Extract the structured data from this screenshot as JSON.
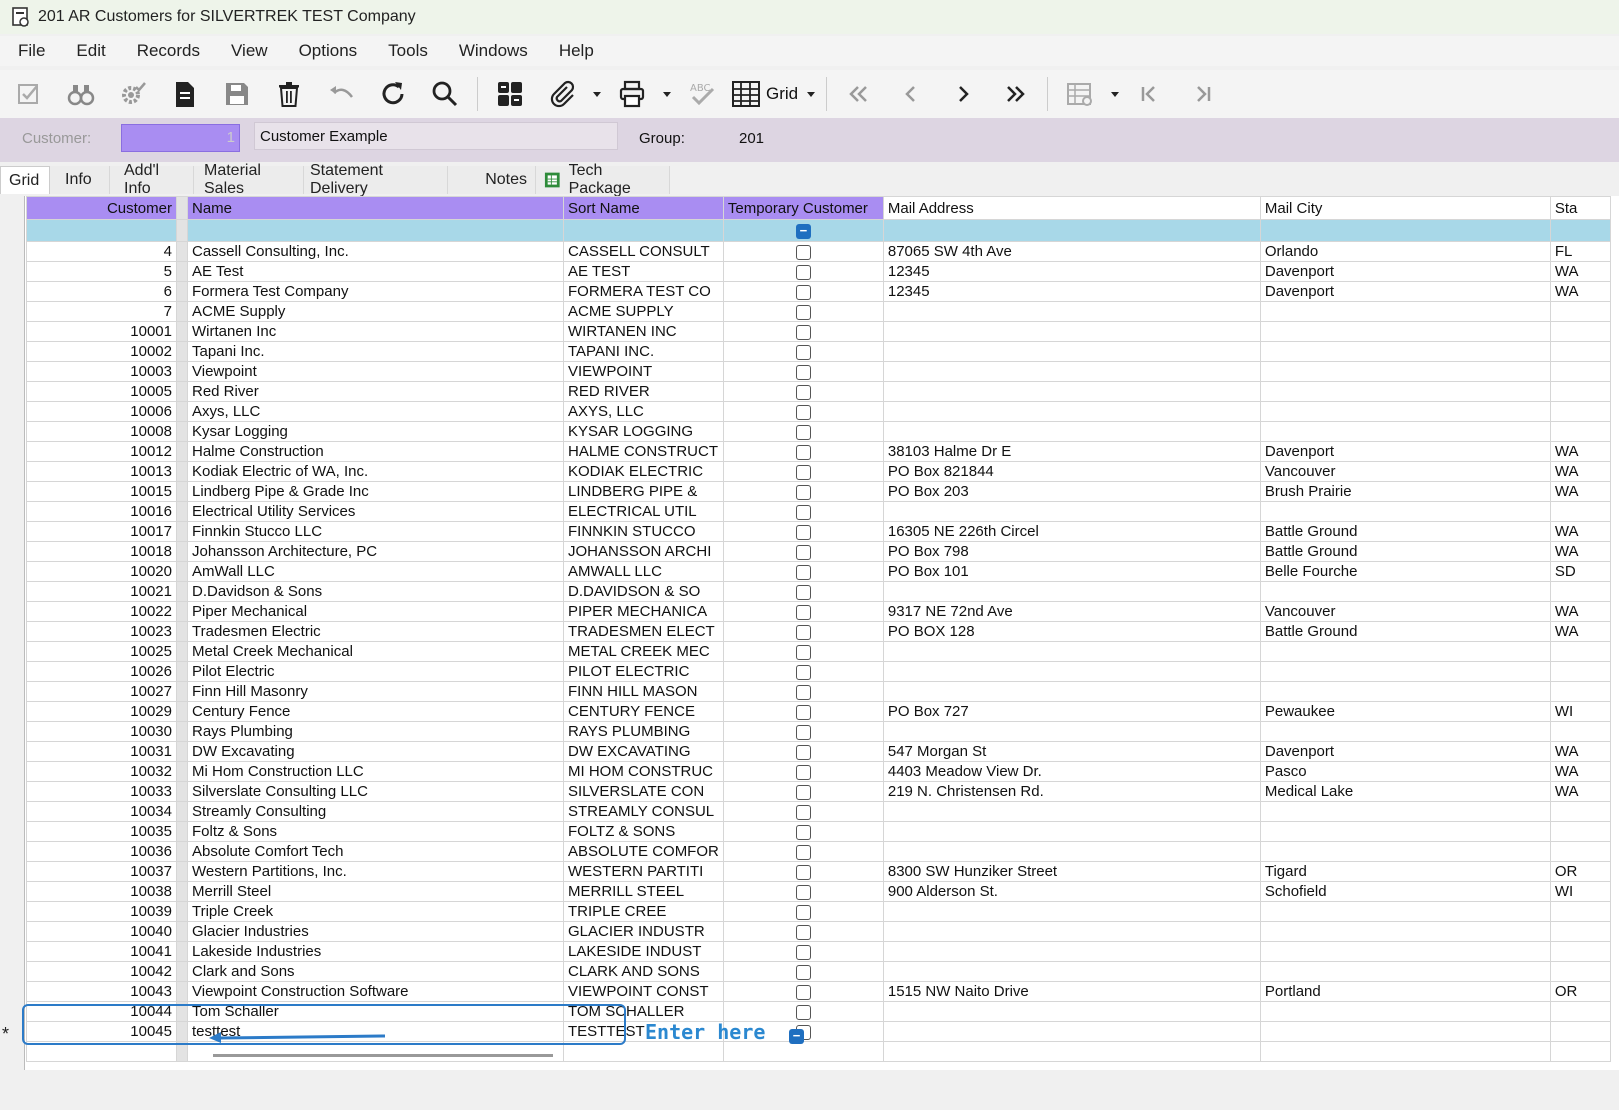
{
  "window": {
    "title": "201 AR Customers for SILVERTREK TEST Company"
  },
  "menu": [
    "File",
    "Edit",
    "Records",
    "View",
    "Options",
    "Tools",
    "Windows",
    "Help"
  ],
  "toolbar": {
    "grid_label": "Grid"
  },
  "header": {
    "customer_label": "Customer:",
    "customer_value": "1",
    "customer_name": "Customer Example",
    "group_label": "Group:",
    "group_value": "201"
  },
  "tabs": [
    "Grid",
    "Info",
    "Add'l Info",
    "Material Sales",
    "Statement Delivery",
    "Notes",
    "Tech Package"
  ],
  "grid": {
    "columns": [
      "Customer",
      "Name",
      "Sort Name",
      "Temporary Customer",
      "Mail Address",
      "Mail City",
      "Sta"
    ],
    "rows": [
      [
        "4",
        "Cassell Consulting, Inc.",
        "CASSELL CONSULT",
        "87065 SW 4th Ave",
        "Orlando",
        "FL"
      ],
      [
        "5",
        "AE Test",
        "AE TEST",
        "12345",
        "Davenport",
        "WA"
      ],
      [
        "6",
        "Formera Test Company",
        "FORMERA TEST CO",
        "12345",
        "Davenport",
        "WA"
      ],
      [
        "7",
        "ACME Supply",
        "ACME SUPPLY",
        "",
        "",
        ""
      ],
      [
        "10001",
        "Wirtanen Inc",
        "WIRTANEN INC",
        "",
        "",
        ""
      ],
      [
        "10002",
        "Tapani Inc.",
        "TAPANI INC.",
        "",
        "",
        ""
      ],
      [
        "10003",
        "Viewpoint",
        "VIEWPOINT",
        "",
        "",
        ""
      ],
      [
        "10005",
        "Red River",
        "RED RIVER",
        "",
        "",
        ""
      ],
      [
        "10006",
        "Axys, LLC",
        "AXYS, LLC",
        "",
        "",
        ""
      ],
      [
        "10008",
        "Kysar Logging",
        "KYSAR LOGGING",
        "",
        "",
        ""
      ],
      [
        "10012",
        "Halme Construction",
        "HALME CONSTRUCT",
        "38103 Halme Dr E",
        "Davenport",
        "WA"
      ],
      [
        "10013",
        "Kodiak Electric of WA, Inc.",
        "KODIAK ELECTRIC",
        "PO Box 821844",
        "Vancouver",
        "WA"
      ],
      [
        "10015",
        "Lindberg Pipe & Grade Inc",
        "LINDBERG PIPE &",
        "PO Box 203",
        "Brush Prairie",
        "WA"
      ],
      [
        "10016",
        "Electrical Utility Services",
        "ELECTRICAL UTIL",
        "",
        "",
        ""
      ],
      [
        "10017",
        "Finnkin Stucco LLC",
        "FINNKIN STUCCO",
        "16305 NE 226th Circel",
        "Battle Ground",
        "WA"
      ],
      [
        "10018",
        "Johansson Architecture, PC",
        "JOHANSSON ARCHI",
        "PO Box 798",
        "Battle Ground",
        "WA"
      ],
      [
        "10020",
        "AmWall LLC",
        "AMWALL LLC",
        "PO Box 101",
        "Belle Fourche",
        "SD"
      ],
      [
        "10021",
        "D.Davidson & Sons",
        "D.DAVIDSON & SO",
        "",
        "",
        ""
      ],
      [
        "10022",
        "Piper Mechanical",
        "PIPER MECHANICA",
        "9317 NE 72nd Ave",
        "Vancouver",
        "WA"
      ],
      [
        "10023",
        "Tradesmen Electric",
        "TRADESMEN ELECT",
        "PO BOX 128",
        "Battle Ground",
        "WA"
      ],
      [
        "10025",
        "Metal Creek Mechanical",
        "METAL CREEK MEC",
        "",
        "",
        ""
      ],
      [
        "10026",
        "Pilot Electric",
        "PILOT ELECTRIC",
        "",
        "",
        ""
      ],
      [
        "10027",
        "Finn Hill Masonry",
        "FINN HILL MASON",
        "",
        "",
        ""
      ],
      [
        "10029",
        "Century Fence",
        "CENTURY FENCE",
        "PO Box 727",
        "Pewaukee",
        "WI"
      ],
      [
        "10030",
        "Rays Plumbing",
        "RAYS PLUMBING",
        "",
        "",
        ""
      ],
      [
        "10031",
        "DW Excavating",
        "DW EXCAVATING",
        "547 Morgan St",
        "Davenport",
        "WA"
      ],
      [
        "10032",
        "Mi Hom Construction LLC",
        "MI HOM CONSTRUC",
        "4403 Meadow View Dr.",
        "Pasco",
        "WA"
      ],
      [
        "10033",
        "Silverslate Consulting LLC",
        "SILVERSLATE CON",
        "219 N. Christensen Rd.",
        "Medical Lake",
        "WA"
      ],
      [
        "10034",
        "Streamly Consulting",
        "STREAMLY CONSUL",
        "",
        "",
        ""
      ],
      [
        "10035",
        "Foltz & Sons",
        "FOLTZ & SONS",
        "",
        "",
        ""
      ],
      [
        "10036",
        "Absolute Comfort Tech",
        "ABSOLUTE COMFOR",
        "",
        "",
        ""
      ],
      [
        "10037",
        "Western Partitions, Inc.",
        "WESTERN PARTITI",
        "8300 SW Hunziker Street",
        "Tigard",
        "OR"
      ],
      [
        "10038",
        "Merrill Steel",
        "MERRILL STEEL",
        "900 Alderson St.",
        "Schofield",
        "WI"
      ],
      [
        "10039",
        "Triple Creek",
        "TRIPLE CREE",
        "",
        "",
        ""
      ],
      [
        "10040",
        "Glacier Industries",
        "GLACIER INDUSTR",
        "",
        "",
        ""
      ],
      [
        "10041",
        "Lakeside Industries",
        "LAKESIDE INDUST",
        "",
        "",
        ""
      ],
      [
        "10042",
        "Clark and Sons",
        "CLARK AND SONS",
        "",
        "",
        ""
      ],
      [
        "10043",
        "Viewpoint Construction Software",
        "VIEWPOINT CONST",
        "1515 NW Naito Drive",
        "Portland",
        "OR"
      ],
      [
        "10044",
        "Tom Schaller",
        "TOM SCHALLER",
        "",
        "",
        ""
      ],
      [
        "10045",
        "testtest",
        "TESTTEST",
        "",
        "",
        ""
      ]
    ],
    "new_row_marker": "*"
  },
  "annotation": {
    "text": "Enter here",
    "color": "#2b88d0"
  },
  "colors": {
    "key_header": "#a98df2",
    "filter_row": "#a8d8e8",
    "header_panel": "#ddd5e2"
  }
}
